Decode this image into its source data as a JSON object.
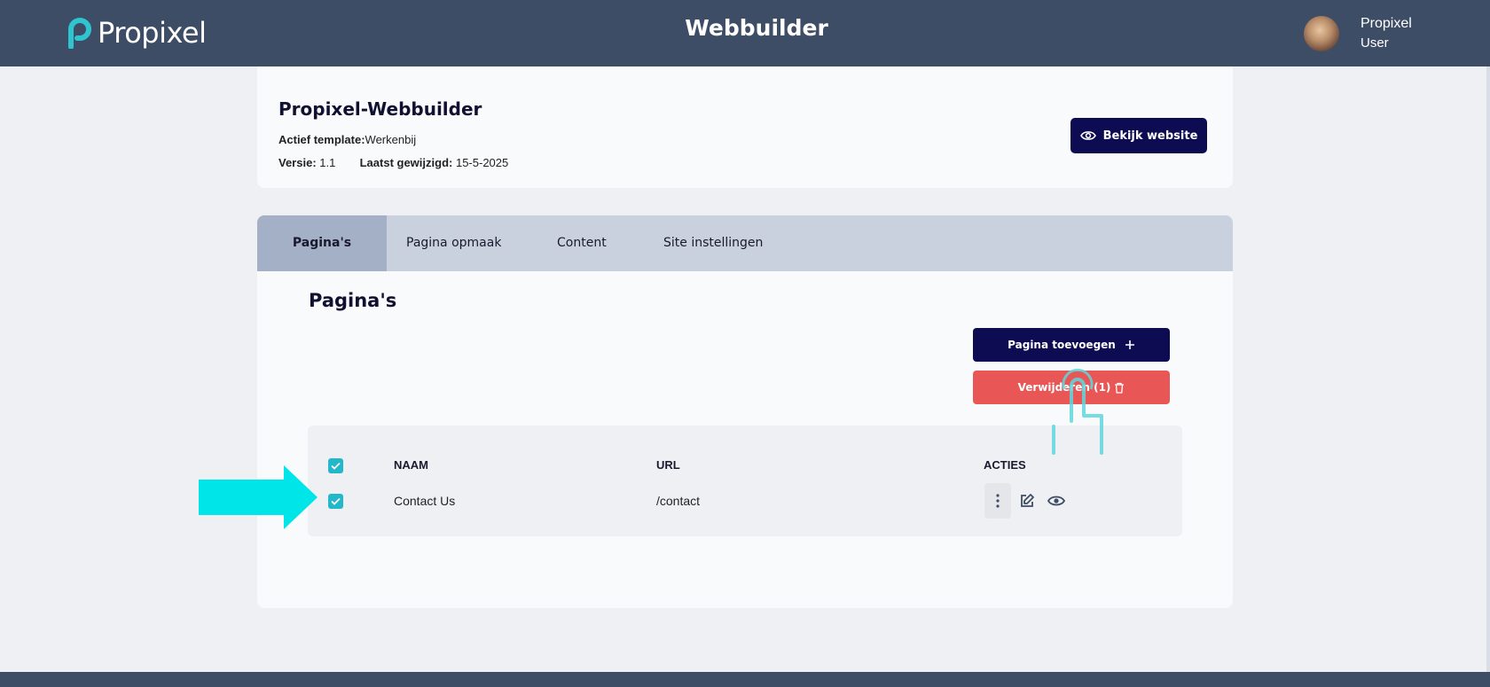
{
  "header": {
    "logo_text": "Propixel",
    "app_title": "Webbuilder",
    "user_name": "Propixel",
    "user_role": "User"
  },
  "site": {
    "title": "Propixel-Webbuilder",
    "template_label": "Actief template:",
    "template_value": "Werkenbij",
    "version_label": "Versie:",
    "version_value": "1.1",
    "modified_label": "Laatst gewijzigd:",
    "modified_value": "15-5-2025",
    "view_button": "Bekijk website"
  },
  "tabs": [
    {
      "label": "Pagina's",
      "active": true
    },
    {
      "label": "Pagina opmaak",
      "active": false
    },
    {
      "label": "Content",
      "active": false
    },
    {
      "label": "Site instellingen",
      "active": false
    }
  ],
  "pages": {
    "title": "Pagina's",
    "add_button": "Pagina toevoegen",
    "delete_button": "Verwijderen (1)",
    "columns": [
      "NAAM",
      "URL",
      "ACTIES"
    ],
    "rows": [
      {
        "checked": true,
        "name": "Contact Us",
        "url": "/contact"
      }
    ],
    "select_all_checked": true
  },
  "icons": {
    "view": "eye-icon",
    "add": "plus-icon",
    "delete": "trash-icon",
    "more": "more-vertical-icon",
    "edit": "edit-icon",
    "preview": "eye-icon"
  },
  "colors": {
    "header_bg": "#3e4d66",
    "primary": "#0d0b52",
    "danger": "#e85656",
    "checkbox": "#22b8c9",
    "highlight": "#00e5e8"
  }
}
